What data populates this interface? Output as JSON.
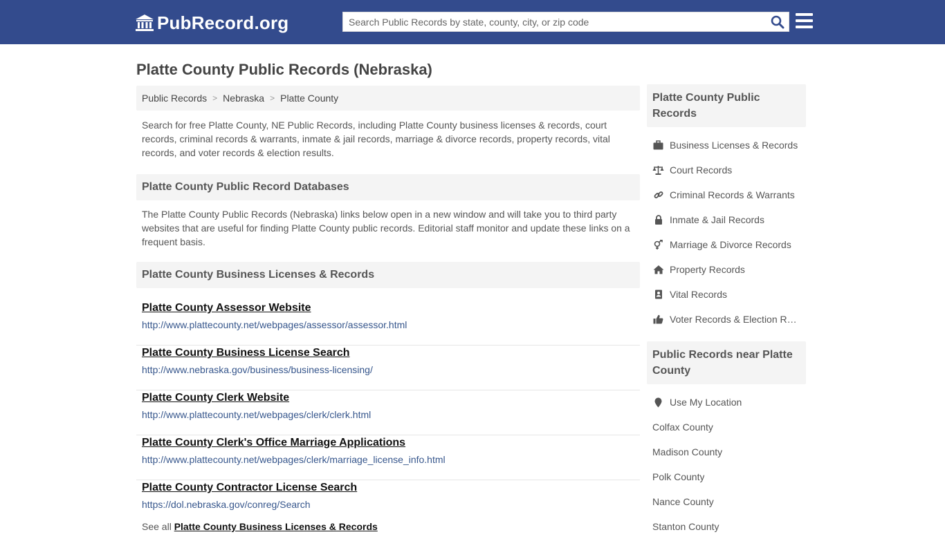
{
  "brand": {
    "name": "PubRecord.org"
  },
  "search": {
    "placeholder": "Search Public Records by state, county, city, or zip code"
  },
  "page": {
    "title": "Platte County Public Records (Nebraska)"
  },
  "breadcrumb": [
    "Public Records",
    "Nebraska",
    "Platte County"
  ],
  "intro": "Search for free Platte County, NE Public Records, including Platte County business licenses & records, court records, criminal records & warrants, inmate & jail records, marriage & divorce records, property records, vital records, and voter records & election results.",
  "databases": {
    "heading": "Platte County Public Record Databases",
    "text": "The Platte County Public Records (Nebraska) links below open in a new window and will take you to third party websites that are useful for finding Platte County public records. Editorial staff monitor and update these links on a frequent basis."
  },
  "business": {
    "heading": "Platte County Business Licenses & Records",
    "links": [
      {
        "title": "Platte County Assessor Website",
        "url": "http://www.plattecounty.net/webpages/assessor/assessor.html"
      },
      {
        "title": "Platte County Business License Search",
        "url": "http://www.nebraska.gov/business/business-licensing/"
      },
      {
        "title": "Platte County Clerk Website",
        "url": "http://www.plattecounty.net/webpages/clerk/clerk.html"
      },
      {
        "title": "Platte County Clerk's Office Marriage Applications",
        "url": "http://www.plattecounty.net/webpages/clerk/marriage_license_info.html"
      },
      {
        "title": "Platte County Contractor License Search",
        "url": "https://dol.nebraska.gov/conreg/Search"
      }
    ],
    "see_all_prefix": "See all",
    "see_all_link": "Platte County Business Licenses & Records"
  },
  "sidebar": {
    "records_heading": "Platte County Public Records",
    "records": [
      {
        "label": "Business Licenses & Records",
        "icon": "briefcase-icon"
      },
      {
        "label": "Court Records",
        "icon": "scales-icon"
      },
      {
        "label": "Criminal Records & Warrants",
        "icon": "link-icon"
      },
      {
        "label": "Inmate & Jail Records",
        "icon": "lock-icon"
      },
      {
        "label": "Marriage & Divorce Records",
        "icon": "marriage-icon"
      },
      {
        "label": "Property Records",
        "icon": "home-icon"
      },
      {
        "label": "Vital Records",
        "icon": "vital-record-icon"
      },
      {
        "label": "Voter Records & Election Results",
        "icon": "thumbs-up-icon"
      }
    ],
    "near_heading": "Public Records near Platte County",
    "location_label": "Use My Location",
    "nearby": [
      "Colfax County",
      "Madison County",
      "Polk County",
      "Nance County",
      "Stanton County"
    ]
  },
  "colors": {
    "header_bg": "#334b8d",
    "link_url": "#36568c",
    "panel_bg": "#f4f4f4"
  }
}
